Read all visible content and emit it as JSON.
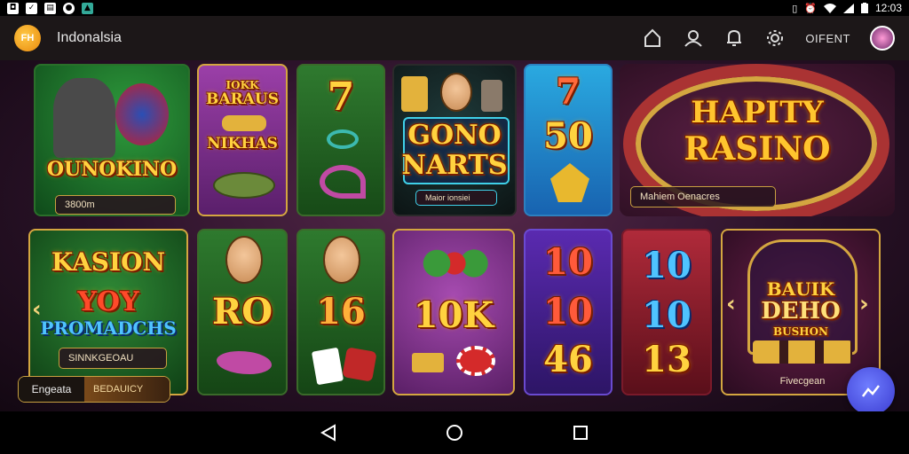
{
  "status_bar": {
    "time": "12:03",
    "left_icons": [
      "notification-icon",
      "check-icon",
      "document-icon",
      "record-icon",
      "image-icon"
    ],
    "right_icons": [
      "vibrate-icon",
      "alarm-icon",
      "wifi-icon",
      "signal-icon",
      "battery-icon"
    ]
  },
  "app_bar": {
    "title": "Indonalsia",
    "logo_glyph": "FH",
    "action_text": "OIFENT"
  },
  "tiles": {
    "t1": {
      "title": "OUNOKINO",
      "pill": "3800m"
    },
    "t2": {
      "line1": "IOKK",
      "line2": "BARAUS",
      "line3": "NIKHAS"
    },
    "t3": {
      "top": "7"
    },
    "t4": {
      "title1": "GONO",
      "title2": "NARTS",
      "pill": "Maior ionsiei"
    },
    "t5": {
      "top": "7",
      "mid": "50"
    },
    "t6": {
      "title1": "HAPITY",
      "title2": "RASINO",
      "pill": "Mahiem Oenacres"
    },
    "t7": {
      "title1": "KASION",
      "title2": "YOY",
      "title3": "PROMADCHS",
      "pill": "SINNKGEOAU"
    },
    "t8": {
      "title": "RO"
    },
    "t9": {
      "title": "16"
    },
    "t10": {
      "title": "10K"
    },
    "t11": {
      "v1": "10",
      "v2": "10",
      "v3": "46"
    },
    "t12": {
      "v1": "10",
      "v2": "10",
      "v3": "13"
    },
    "t13": {
      "title1": "BAUIK",
      "title2": "DEHO",
      "title3": "BUSHON",
      "footer": "Fivecgean"
    }
  },
  "bottom_pill": {
    "left": "Engeata",
    "right": "BEDAUICY"
  },
  "colors": {
    "gold": "#ffd23f",
    "appbar": "#1c1718",
    "fab": "#4a4fe0"
  }
}
